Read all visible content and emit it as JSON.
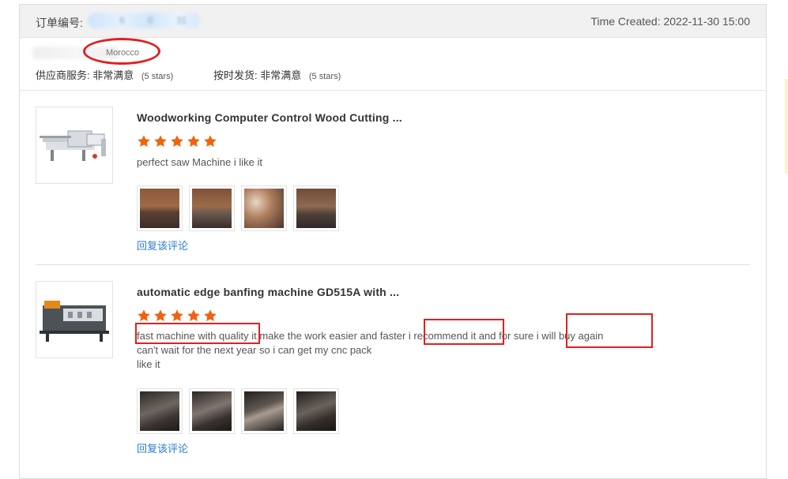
{
  "order": {
    "number_label": "订单编号:",
    "time_created": "Time Created: 2022-11-30 15:00"
  },
  "buyer": {
    "country": "Morocco"
  },
  "ratings": {
    "supplier_service_label": "供应商服务:",
    "supplier_service_value": "非常满意",
    "supplier_service_stars": "(5 stars)",
    "on_time_label": "按时发货:",
    "on_time_value": "非常满意",
    "on_time_stars": "(5 stars)"
  },
  "reviews": [
    {
      "title": "Woodworking Computer Control Wood Cutting ...",
      "rating": 5,
      "comment_lines": [
        "perfect saw Machine i like it"
      ],
      "reply_label": "回复该评论"
    },
    {
      "title": "automatic edge banfing machine GD515A with ...",
      "rating": 5,
      "comment_lines": [
        "fast machine with quality it make the work easier and faster i recommend it and for sure i will buy again",
        "can't wait for the next year so i can get my cnc pack",
        "like it"
      ],
      "reply_label": "回复该评论"
    }
  ],
  "colors": {
    "star": "#f2620b",
    "link": "#2b7fd1",
    "annotation": "#e02020"
  }
}
